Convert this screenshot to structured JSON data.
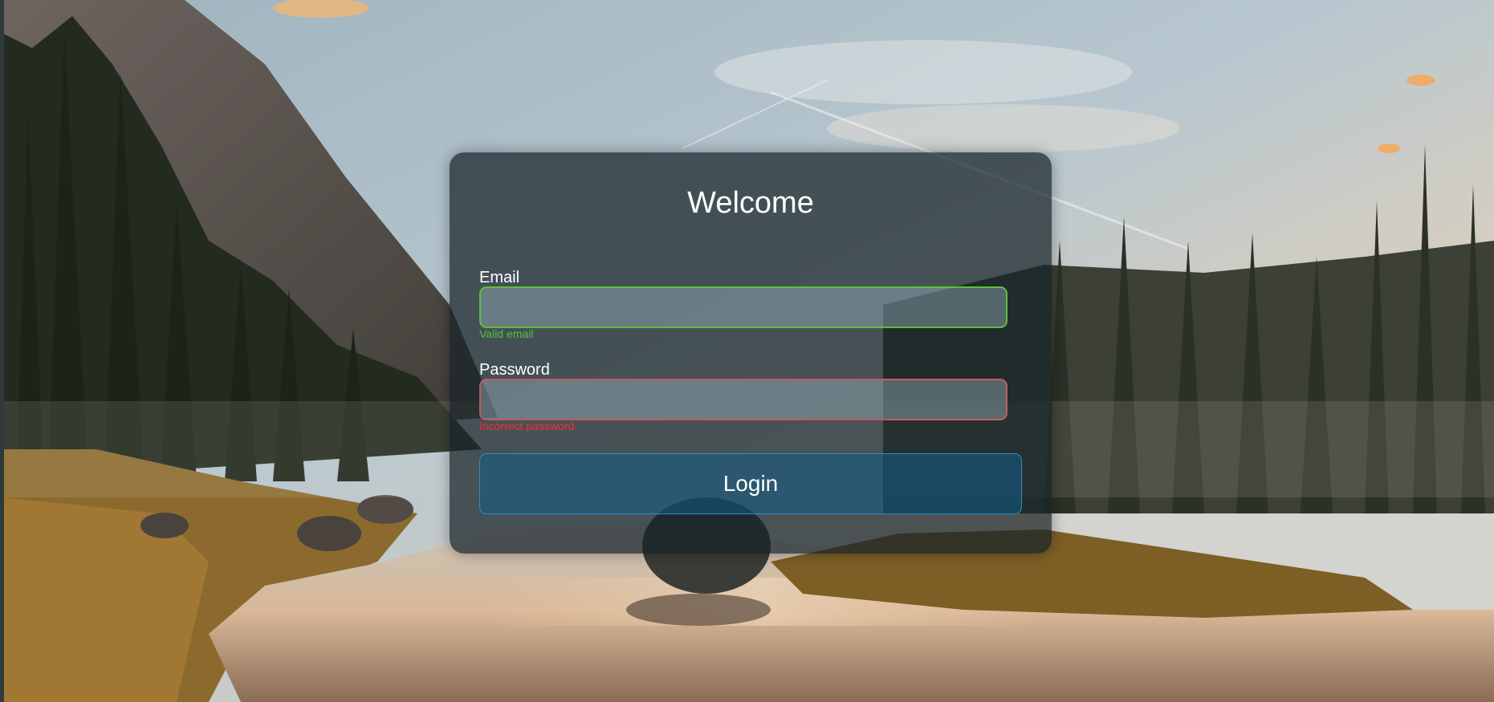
{
  "card": {
    "title": "Welcome"
  },
  "email": {
    "label": "Email",
    "value": "",
    "status": "valid",
    "message": "Valid email",
    "message_color": "#5fbf3a",
    "border_color": "#5fbf3a"
  },
  "password": {
    "label": "Password",
    "value": "",
    "status": "invalid",
    "message": "Incorrect password",
    "message_color": "#ff2a2a",
    "border_color": "#c45a5a"
  },
  "login_button": {
    "label": "Login",
    "accent": "#2b8ec8"
  },
  "background": {
    "scene": "mountain-river-sunset-photo"
  }
}
